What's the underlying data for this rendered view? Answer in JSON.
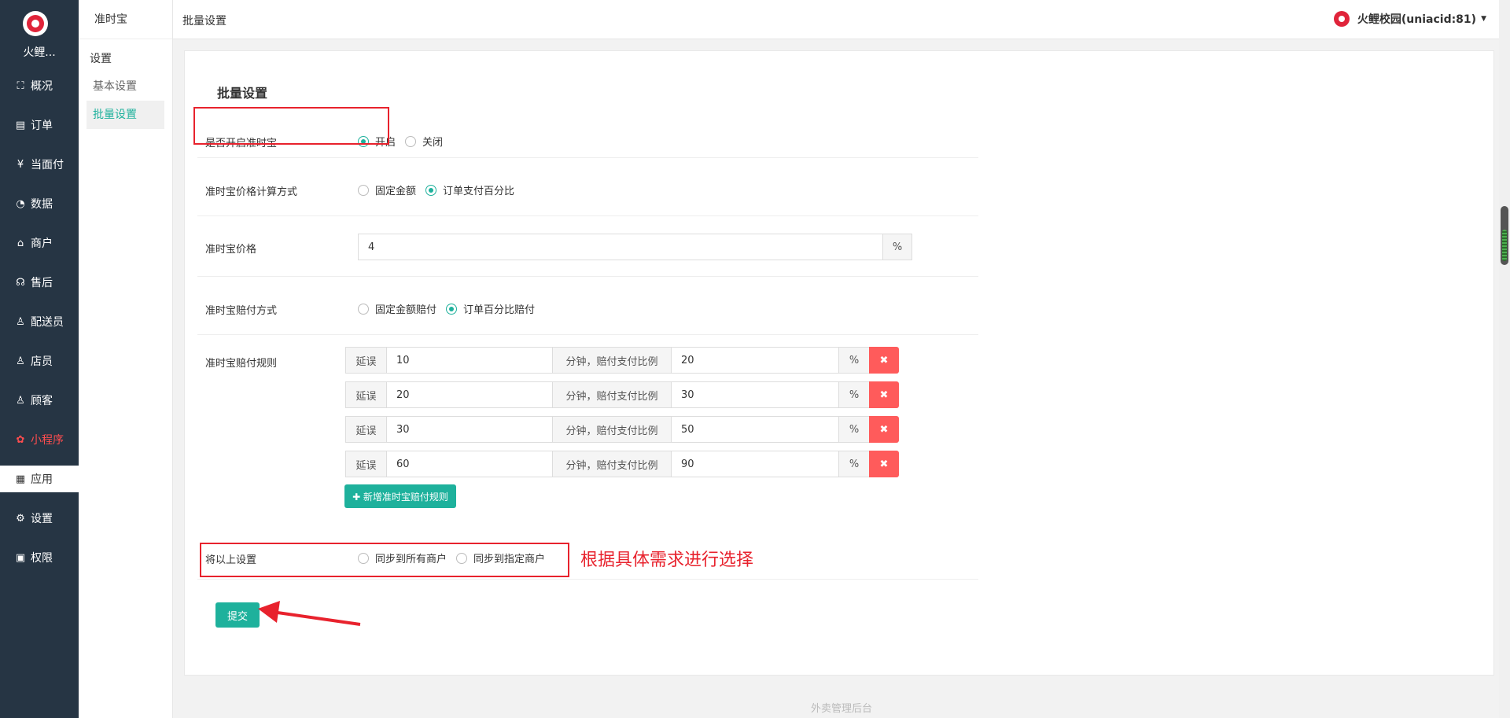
{
  "sidebar": {
    "logo_text": "火鲤...",
    "items": [
      {
        "label": "概况",
        "icon": "⛶",
        "icon_name": "dashboard-icon"
      },
      {
        "label": "订单",
        "icon": "▤",
        "icon_name": "order-icon"
      },
      {
        "label": "当面付",
        "icon": "¥",
        "icon_name": "payment-icon"
      },
      {
        "label": "数据",
        "icon": "◔",
        "icon_name": "chart-icon"
      },
      {
        "label": "商户",
        "icon": "⌂",
        "icon_name": "store-icon"
      },
      {
        "label": "售后",
        "icon": "☊",
        "icon_name": "after-sales-icon"
      },
      {
        "label": "配送员",
        "icon": "♙",
        "icon_name": "courier-icon"
      },
      {
        "label": "店员",
        "icon": "♙",
        "icon_name": "clerk-icon"
      },
      {
        "label": "顾客",
        "icon": "♙",
        "icon_name": "customer-icon"
      },
      {
        "label": "小程序",
        "icon": "✿",
        "icon_name": "miniprogram-icon"
      },
      {
        "label": "应用",
        "icon": "▦",
        "icon_name": "apps-icon"
      },
      {
        "label": "设置",
        "icon": "⚙",
        "icon_name": "gear-icon"
      },
      {
        "label": "权限",
        "icon": "🔒",
        "icon_name": "lock-icon"
      }
    ]
  },
  "subbar": {
    "title": "准时宝",
    "group": "设置",
    "items": [
      "基本设置",
      "批量设置"
    ]
  },
  "topbar": {
    "breadcrumb": "批量设置",
    "user": "火鲤校园(uniacid:81)"
  },
  "form": {
    "title": "批量设置",
    "enable_label": "是否开启准时宝",
    "enable_on": "开启",
    "enable_off": "关闭",
    "price_mode_label": "准时宝价格计算方式",
    "price_mode_fixed": "固定金额",
    "price_mode_percent": "订单支付百分比",
    "price_label": "准时宝价格",
    "price_value": "4",
    "price_unit": "%",
    "comp_mode_label": "准时宝赔付方式",
    "comp_mode_fixed": "固定金额赔付",
    "comp_mode_percent": "订单百分比赔付",
    "rules_label": "准时宝赔付规则",
    "rule_prefix": "延误",
    "rule_middle": "分钟，赔付支付比例",
    "rule_unit": "%",
    "rule_delete": "✖",
    "rules": [
      {
        "minutes": "10",
        "ratio": "20"
      },
      {
        "minutes": "20",
        "ratio": "30"
      },
      {
        "minutes": "30",
        "ratio": "50"
      },
      {
        "minutes": "60",
        "ratio": "90"
      }
    ],
    "add_rule": "✚ 新增准时宝赔付规则",
    "sync_label": "将以上设置",
    "sync_all": "同步到所有商户",
    "sync_some": "同步到指定商户",
    "submit": "提交"
  },
  "annotation": {
    "text": "根据具体需求进行选择"
  },
  "footer": "外卖管理后台"
}
